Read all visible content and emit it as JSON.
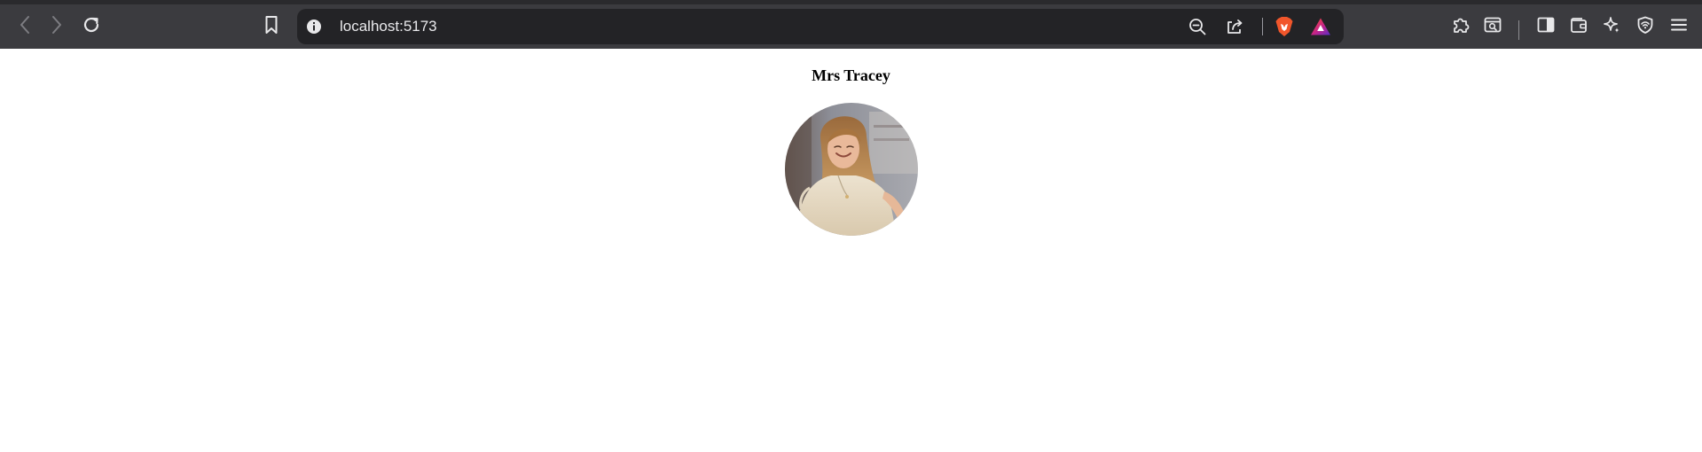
{
  "browser": {
    "address": "localhost:5173",
    "icons": {
      "back": "chevron-left-icon",
      "forward": "chevron-right-icon",
      "reload": "reload-icon",
      "bookmark": "bookmark-icon",
      "site_info": "info-icon",
      "zoom": "zoom-out-icon",
      "share": "share-icon",
      "brave_shields": "brave-lion-icon",
      "brave_rewards": "brave-rewards-triangle-icon",
      "extensions": "puzzle-icon",
      "tab_search": "tab-search-icon",
      "sidebar": "sidebar-icon",
      "wallet": "wallet-icon",
      "leo": "sparkle-icon",
      "vpn": "vpn-shield-icon",
      "menu": "hamburger-menu-icon"
    },
    "colors": {
      "toolbar": "#3b3b3f",
      "urlbar": "#232326",
      "brave_orange": "#f1562b",
      "rewards_purple": "#7b2fa8"
    }
  },
  "page": {
    "name": "Mrs Tracey",
    "avatar": "profile-photo"
  }
}
